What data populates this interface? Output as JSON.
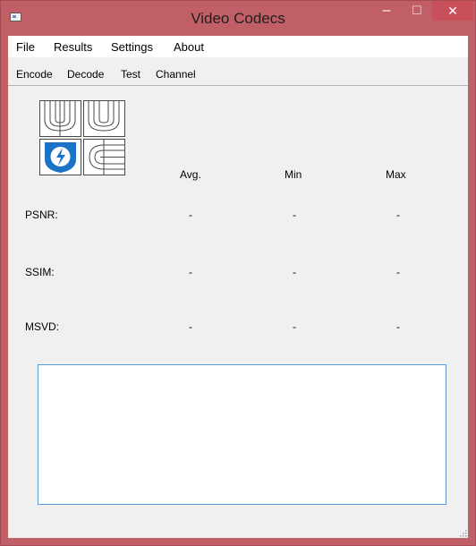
{
  "window": {
    "title": "Video Codecs"
  },
  "menubar": {
    "file": "File",
    "results": "Results",
    "settings": "Settings",
    "about": "About"
  },
  "toolbar": {
    "encode": "Encode",
    "decode": "Decode",
    "test": "Test",
    "channel": "Channel"
  },
  "metrics": {
    "headers": {
      "avg": "Avg.",
      "min": "Min",
      "max": "Max"
    },
    "rows": [
      {
        "label": "PSNR:",
        "avg": "-",
        "min": "-",
        "max": "-"
      },
      {
        "label": "SSIM:",
        "avg": "-",
        "min": "-",
        "max": "-"
      },
      {
        "label": "MSVD:",
        "avg": "-",
        "min": "-",
        "max": "-"
      }
    ]
  },
  "output": {
    "text": ""
  },
  "colors": {
    "titlebar": "#c05f65",
    "close": "#c7505a",
    "accent_border": "#5b9bd5",
    "logo_blue": "#1a73c6"
  }
}
